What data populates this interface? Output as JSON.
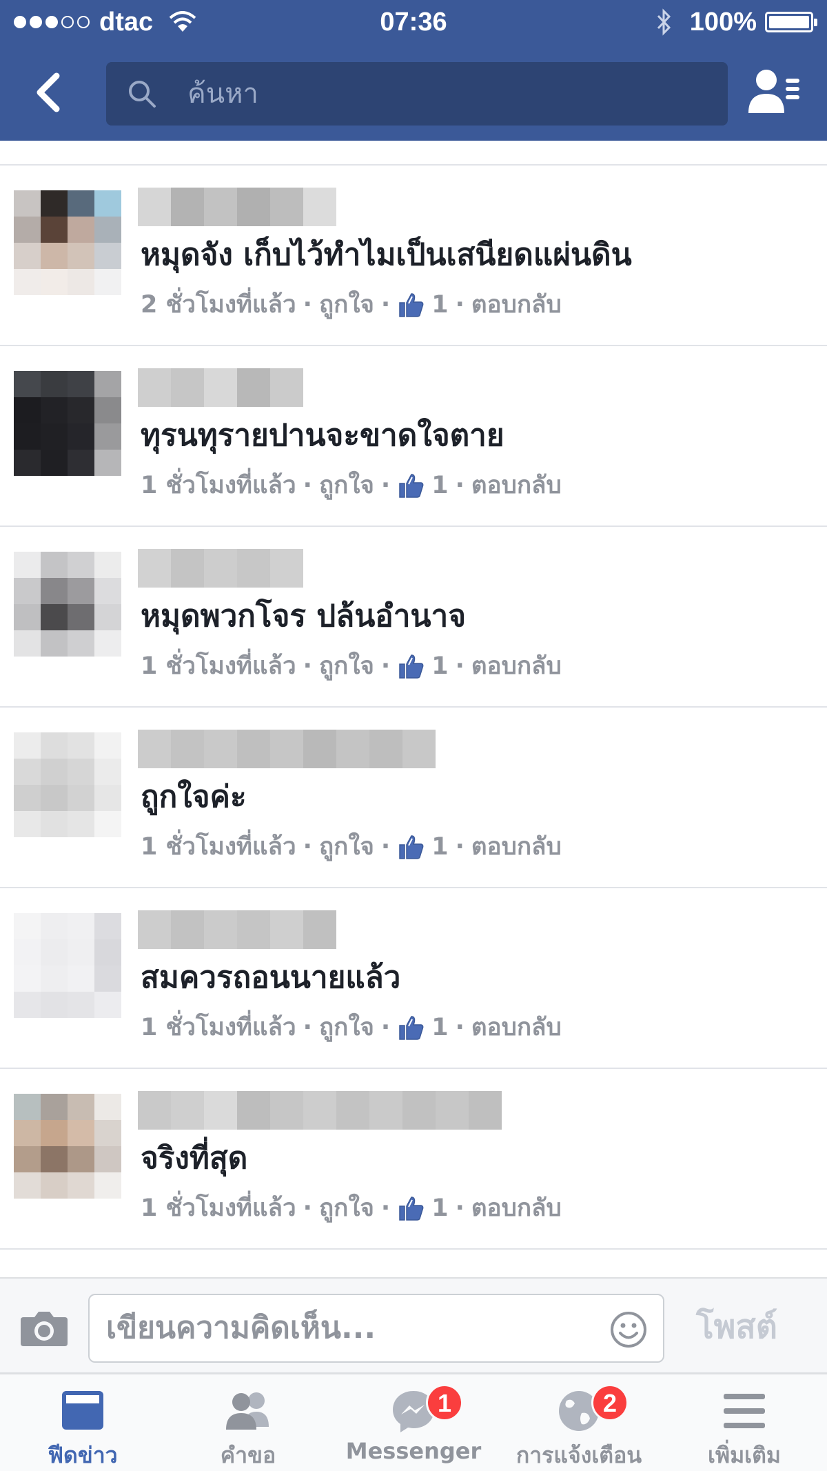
{
  "status_bar": {
    "carrier": "dtac",
    "time": "07:36",
    "battery": "100%"
  },
  "nav": {
    "search_placeholder": "ค้นหา"
  },
  "comments": [
    {
      "text": "หมุดจัง     เก็บไว้ทำไมเป็นเสนียดแผ่นดิน",
      "time": "2 ชั่วโมงที่แล้ว",
      "like": "ถูกใจ",
      "likes": "1",
      "reply": "ตอบกลับ"
    },
    {
      "text": "ทุรนทุรายปานจะขาดใจตาย",
      "time": "1 ชั่วโมงที่แล้ว",
      "like": "ถูกใจ",
      "likes": "1",
      "reply": "ตอบกลับ"
    },
    {
      "text": "หมุดพวกโจร ปล้นอำนาจ",
      "time": "1 ชั่วโมงที่แล้ว",
      "like": "ถูกใจ",
      "likes": "1",
      "reply": "ตอบกลับ"
    },
    {
      "text": "ถูกใจค่ะ",
      "time": "1 ชั่วโมงที่แล้ว",
      "like": "ถูกใจ",
      "likes": "1",
      "reply": "ตอบกลับ"
    },
    {
      "text": "สมควรถอนนายแล้ว",
      "time": "1 ชั่วโมงที่แล้ว",
      "like": "ถูกใจ",
      "likes": "1",
      "reply": "ตอบกลับ"
    },
    {
      "text": "จริงที่สุด",
      "time": "1 ชั่วโมงที่แล้ว",
      "like": "ถูกใจ",
      "likes": "1",
      "reply": "ตอบกลับ"
    }
  ],
  "composer": {
    "placeholder": "เขียนความคิดเห็น...",
    "post_label": "โพสต์"
  },
  "tabs": [
    {
      "label": "ฟีดข่าว",
      "icon": "news-feed-icon",
      "active": true
    },
    {
      "label": "คำขอ",
      "icon": "friend-requests-icon"
    },
    {
      "label": "Messenger",
      "icon": "messenger-icon",
      "badge": "1"
    },
    {
      "label": "การแจ้งเตือน",
      "icon": "globe-notifications-icon",
      "badge": "2"
    },
    {
      "label": "เพิ่มเติม",
      "icon": "menu-icon"
    }
  ],
  "colors": {
    "brand": "#3b5998",
    "badge": "#fa3e3e",
    "active_tab": "#4267b2"
  }
}
